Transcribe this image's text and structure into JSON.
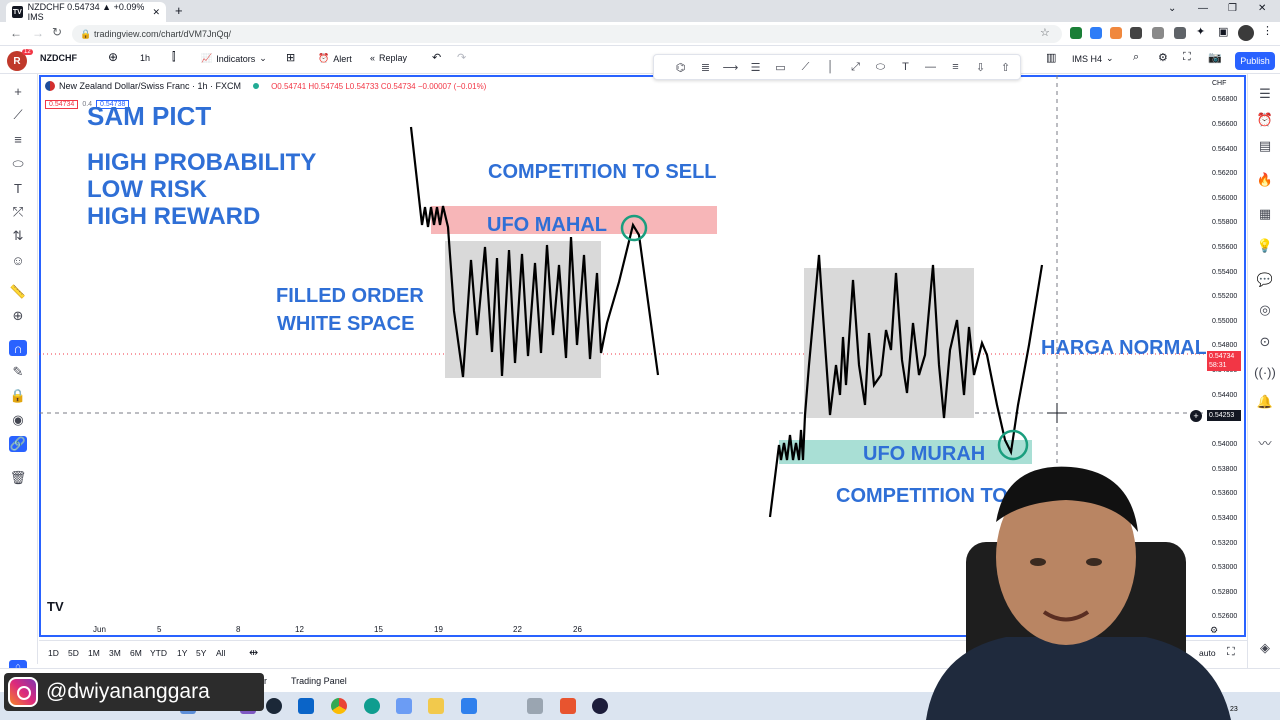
{
  "browser": {
    "tab_title": "NZDCHF 0.54734 ▲ +0.09% IMS",
    "url": "tradingview.com/chart/dVM7JnQq/"
  },
  "toolbar": {
    "symbol": "NZDCHF",
    "interval": "1h",
    "indicators_label": "Indicators",
    "alert_label": "Alert",
    "replay_label": "Replay",
    "layout_name": "IMS H4",
    "publish_label": "Publish",
    "profile_badge": "12"
  },
  "legend": {
    "title": "New Zealand Dollar/Swiss Franc · 1h · FXCM",
    "ohlc": "O0.54741 H0.54745 L0.54733 C0.54734 −0.00007 (−0.01%)",
    "sell_price": "0.54734",
    "spread": "0.4",
    "buy_price": "0.54738"
  },
  "price_scale": {
    "currency": "CHF",
    "ticks": [
      "0.56800",
      "0.56600",
      "0.56400",
      "0.56200",
      "0.56000",
      "0.55800",
      "0.55600",
      "0.55400",
      "0.55200",
      "0.55000",
      "0.54800",
      "0.54600",
      "0.54400",
      "0.54200",
      "0.54000",
      "0.53800",
      "0.53600",
      "0.53400",
      "0.53200",
      "0.53000",
      "0.52800",
      "0.52600"
    ],
    "current_price": "0.54734",
    "countdown": "58:31",
    "cursor_price": "0.54253",
    "colors": {
      "current": "#f23645",
      "cursor": "#131722"
    }
  },
  "time_scale": {
    "ticks": [
      "Jun",
      "5",
      "8",
      "12",
      "15",
      "19",
      "22",
      "26"
    ]
  },
  "annotations": {
    "brand": "SAM PICT",
    "tagline_1": "HIGH PROBABILITY",
    "tagline_2": "LOW RISK",
    "tagline_3": "HIGH REWARD",
    "competition_sell": "COMPETITION TO SELL",
    "ufo_mahal": "UFO MAHAL",
    "filled_order_1": "FILLED ORDER",
    "filled_order_2": "WHITE SPACE",
    "harga_normal": "HARGA NORMAL",
    "ufo_murah": "UFO MURAH",
    "competition_buy": "COMPETITION TO",
    "colors": {
      "text": "#2f6fd6",
      "mahal_zone": "#f7b6b8",
      "murah_zone": "#a9dfd5",
      "range_box": "#d9d9d9",
      "circle": "#1a9e7e"
    }
  },
  "bottom_bar": {
    "ranges": [
      "1D",
      "5D",
      "1M",
      "3M",
      "6M",
      "YTD",
      "1Y",
      "5Y",
      "All"
    ],
    "auto_label": "auto"
  },
  "panel_bar": {
    "tab_partial": "r",
    "trading_panel": "Trading Panel"
  },
  "overlay": {
    "instagram_handle": "@dwiyananggara"
  },
  "taskbar": {
    "clock_partial": "23"
  }
}
